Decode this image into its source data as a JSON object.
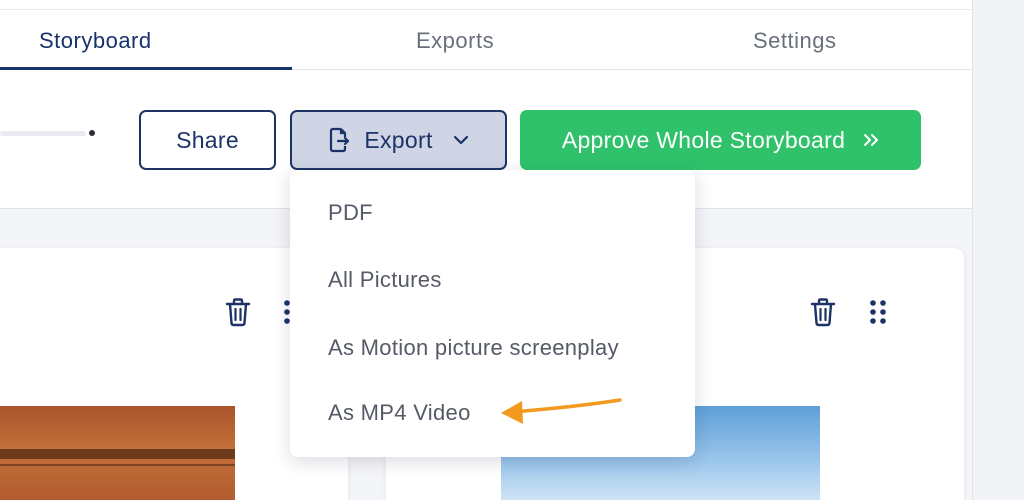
{
  "tabs": [
    {
      "label": "Storyboard",
      "active": true
    },
    {
      "label": "Exports",
      "active": false
    },
    {
      "label": "Settings",
      "active": false
    }
  ],
  "toolbar": {
    "share_label": "Share",
    "export_label": "Export",
    "approve_label": "Approve Whole Storyboard"
  },
  "export_menu": {
    "items": [
      {
        "label": "PDF"
      },
      {
        "label": "All Pictures"
      },
      {
        "label": "As Motion picture screenplay"
      },
      {
        "label": "As MP4 Video",
        "highlighted": true
      }
    ]
  },
  "icons": {
    "export": "file-export-icon",
    "chevron": "chevron-down-icon",
    "approve": "double-chevron-right-icon",
    "delete": "trash-icon",
    "drag": "drag-handle-icon"
  },
  "colors": {
    "primary": "#18326b",
    "approve": "#2fc26a",
    "annotation_arrow": "#f29a1f",
    "export_bg": "#cfd5e5"
  }
}
